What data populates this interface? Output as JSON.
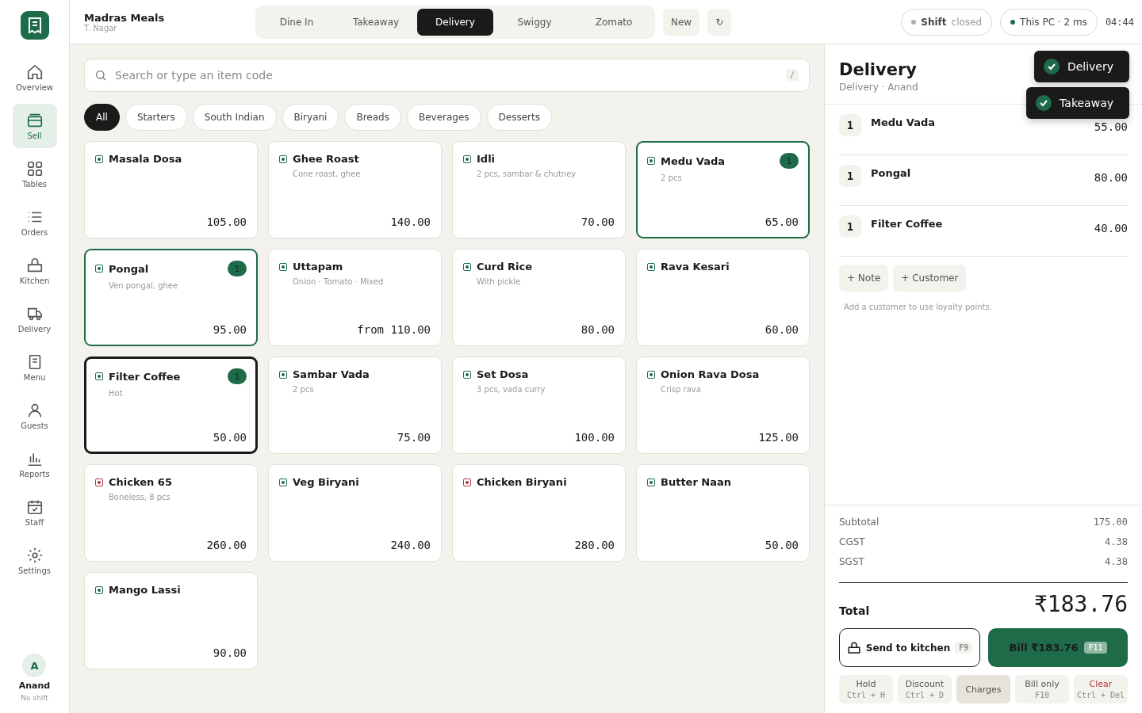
{
  "brand": {
    "name": "Madras Meals",
    "branch": "T. Nagar"
  },
  "nav": [
    {
      "label": "Overview",
      "selected": false
    },
    {
      "label": "Sell",
      "selected": true
    },
    {
      "label": "Tables",
      "selected": false
    },
    {
      "label": "Orders",
      "selected": false
    },
    {
      "label": "Kitchen",
      "selected": false
    },
    {
      "label": "Delivery",
      "selected": false
    },
    {
      "label": "Menu",
      "selected": false
    },
    {
      "label": "Guests",
      "selected": false
    },
    {
      "label": "Reports",
      "selected": false
    },
    {
      "label": "Staff",
      "selected": false
    },
    {
      "label": "Settings",
      "selected": false
    }
  ],
  "user": {
    "initial": "A",
    "name": "Anand",
    "status": "No shift"
  },
  "order_types": [
    {
      "label": "Dine In",
      "selected": false
    },
    {
      "label": "Takeaway",
      "selected": false
    },
    {
      "label": "Delivery",
      "selected": true
    },
    {
      "label": "Swiggy",
      "selected": false
    },
    {
      "label": "Zomato",
      "selected": false
    }
  ],
  "new_button": "New",
  "refresh_button": "↻",
  "shift": {
    "label": "Shift",
    "value": "closed",
    "color": "#b0aca4"
  },
  "connection": {
    "label": "This PC · 2 ms",
    "color": "#1e6b4a"
  },
  "clock": "04:44",
  "search": {
    "placeholder": "Search or type an item code",
    "shortcut": "/"
  },
  "categories": [
    {
      "label": "All",
      "selected": true
    },
    {
      "label": "Starters",
      "selected": false
    },
    {
      "label": "South Indian",
      "selected": false
    },
    {
      "label": "Biryani",
      "selected": false
    },
    {
      "label": "Breads",
      "selected": false
    },
    {
      "label": "Beverages",
      "selected": false
    },
    {
      "label": "Desserts",
      "selected": false
    }
  ],
  "items": [
    {
      "name": "Masala Dosa",
      "price": "105.00",
      "color": "#1e6b4a",
      "focused": false
    },
    {
      "name": "Ghee Roast",
      "desc": "Cone roast, ghee",
      "price": "140.00",
      "color": "#1e6b4a",
      "focused": false
    },
    {
      "name": "Idli",
      "desc": "2 pcs, sambar & chutney",
      "price": "70.00",
      "color": "#1e6b4a",
      "focused": false
    },
    {
      "name": "Medu Vada",
      "desc": "2 pcs",
      "price": "65.00",
      "color": "#1e6b4a",
      "qty": "1",
      "focused": false
    },
    {
      "name": "Pongal",
      "desc": "Ven pongal, ghee",
      "price": "95.00",
      "color": "#1e6b4a",
      "qty": "1",
      "focused": false
    },
    {
      "name": "Uttapam",
      "desc": "Onion · Tomato · Mixed",
      "price": "from 110.00",
      "color": "#1e6b4a",
      "focused": false
    },
    {
      "name": "Curd Rice",
      "desc": "With pickle",
      "price": "80.00",
      "color": "#1e6b4a",
      "focused": false
    },
    {
      "name": "Rava Kesari",
      "price": "60.00",
      "color": "#1e6b4a",
      "focused": false
    },
    {
      "name": "Filter Coffee",
      "desc": "Hot",
      "price": "50.00",
      "color": "#1e6b4a",
      "qty": "1",
      "focused": true
    },
    {
      "name": "Sambar Vada",
      "desc": "2 pcs",
      "price": "75.00",
      "color": "#1e6b4a",
      "focused": false
    },
    {
      "name": "Set Dosa",
      "desc": "3 pcs, vada curry",
      "price": "100.00",
      "color": "#1e6b4a",
      "focused": false
    },
    {
      "name": "Onion Rava Dosa",
      "desc": "Crisp rava",
      "price": "125.00",
      "color": "#1e6b4a",
      "focused": false
    },
    {
      "name": "Chicken 65",
      "desc": "Boneless, 8 pcs",
      "price": "260.00",
      "color": "#b03a3a",
      "focused": false
    },
    {
      "name": "Veg Biryani",
      "price": "240.00",
      "color": "#1e6b4a",
      "focused": false
    },
    {
      "name": "Chicken Biryani",
      "price": "280.00",
      "color": "#b03a3a",
      "focused": false
    },
    {
      "name": "Butter Naan",
      "price": "50.00",
      "color": "#1e6b4a",
      "focused": false
    },
    {
      "name": "Mango Lassi",
      "price": "90.00",
      "color": "#1e6b4a",
      "focused": false
    }
  ],
  "order": {
    "title": "Delivery",
    "subtitle": "Delivery · Anand",
    "lines": [
      {
        "qty": "1",
        "name": "Medu Vada",
        "price": "55.00"
      },
      {
        "qty": "1",
        "name": "Pongal",
        "price": "80.00"
      },
      {
        "qty": "1",
        "name": "Filter Coffee",
        "price": "40.00"
      }
    ],
    "note_button": "+ Note",
    "customer_button": "+ Customer",
    "hint": "Add a customer to use loyalty points.",
    "summary": [
      {
        "label": "Subtotal",
        "value": "175.00"
      },
      {
        "label": "CGST",
        "value": "4.38"
      },
      {
        "label": "SGST",
        "value": "4.38"
      }
    ],
    "total_label": "Total",
    "total": "₹183.76",
    "send_button": {
      "label": "Send to kitchen",
      "key": "F9"
    },
    "bill_button": {
      "label": "Bill ₹183.76",
      "key": "F11"
    },
    "actions": [
      {
        "label": "Hold",
        "key": "Ctrl + H",
        "kind": "normal"
      },
      {
        "label": "Discount",
        "key": "Ctrl + D",
        "kind": "normal"
      },
      {
        "label": "Charges",
        "kind": "strong"
      },
      {
        "label": "Bill only",
        "key": "F10",
        "kind": "normal"
      },
      {
        "label": "Clear",
        "key": "Ctrl + Del",
        "kind": "danger"
      }
    ]
  },
  "toasts": [
    {
      "label": "Delivery"
    },
    {
      "label": "Takeaway"
    }
  ]
}
